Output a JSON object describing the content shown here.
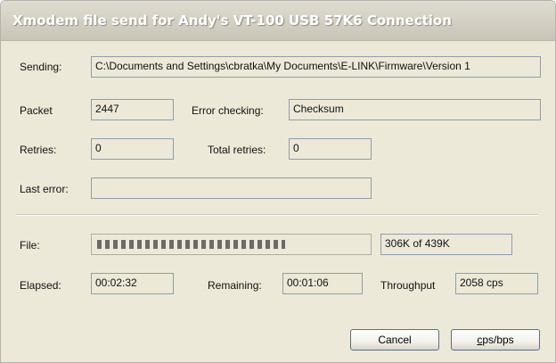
{
  "window": {
    "title": "Xmodem file send for Andy's VT-100 USB 57K6 Connection"
  },
  "sending": {
    "label": "Sending:",
    "value": "C:\\Documents and Settings\\cbratka\\My Documents\\E-LINK\\Firmware\\Version 1"
  },
  "packet": {
    "label": "Packet",
    "value": "2447"
  },
  "error_checking": {
    "label": "Error checking:",
    "value": "Checksum"
  },
  "retries": {
    "label": "Retries:",
    "value": "0"
  },
  "total_retries": {
    "label": "Total retries:",
    "value": "0"
  },
  "last_error": {
    "label": "Last error:",
    "value": ""
  },
  "file": {
    "label": "File:",
    "progress_fraction": 0.7,
    "size_text": "306K of 439K"
  },
  "elapsed": {
    "label": "Elapsed:",
    "value": "00:02:32"
  },
  "remaining": {
    "label": "Remaining:",
    "value": "00:01:06"
  },
  "throughput": {
    "label": "Throughput",
    "value": "2058 cps"
  },
  "buttons": {
    "cancel": "Cancel",
    "cps_bps_first": "c",
    "cps_bps_rest": "ps/bps"
  }
}
